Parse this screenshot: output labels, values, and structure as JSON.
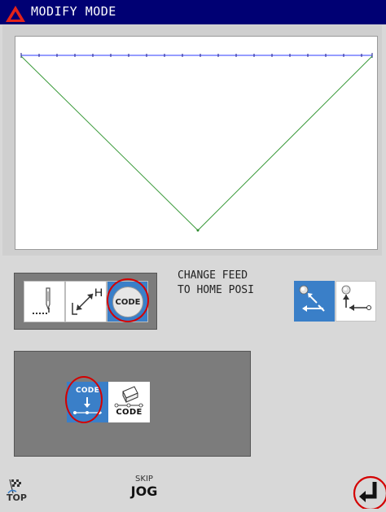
{
  "title_bar": {
    "title": "MODIFY MODE",
    "background_color": "#000073",
    "logo": "red-triangle-logo"
  },
  "canvas": {
    "icon": "stitch-pattern",
    "line_colors": {
      "stitch_line": "#0000ff",
      "triangle": "#2e8b2e"
    }
  },
  "mode_buttons": [
    {
      "icon": "needle-stitch-icon",
      "active": false
    },
    {
      "icon": "height-adjust-icon",
      "label": "H",
      "active": false
    },
    {
      "icon": "code-disc-icon",
      "label": "CODE",
      "active": true,
      "highlighted": true
    }
  ],
  "change_feed": {
    "line1": "CHANGE FEED",
    "line2": "TO HOME POSI"
  },
  "home_buttons": [
    {
      "icon": "feed-to-home-icon",
      "active": true
    },
    {
      "icon": "return-home-icon",
      "active": false
    }
  ],
  "code_buttons": [
    {
      "label": "CODE",
      "icon": "code-insert-icon",
      "active": true,
      "highlighted": true
    },
    {
      "label": "CODE",
      "icon": "code-eraser-icon",
      "active": false
    }
  ],
  "footer": {
    "top_label": "TOP",
    "skip_label": "SKIP",
    "jog_label": "JOG"
  },
  "accent_colors": {
    "active_button": "#3a7fc8",
    "highlight_ring": "#d40000"
  }
}
